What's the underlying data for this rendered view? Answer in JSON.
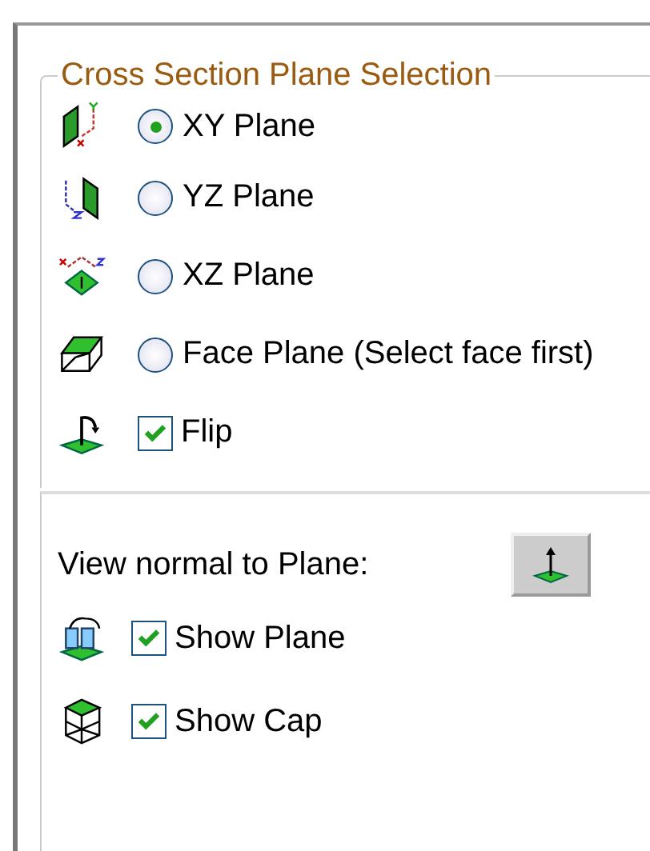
{
  "group": {
    "title": "Cross Section Plane Selection",
    "options": [
      {
        "kind": "radio",
        "label": "XY Plane",
        "selected": true
      },
      {
        "kind": "radio",
        "label": "YZ Plane",
        "selected": false
      },
      {
        "kind": "radio",
        "label": "XZ Plane",
        "selected": false
      },
      {
        "kind": "radio",
        "label": "Face Plane (Select face first)",
        "selected": false
      },
      {
        "kind": "checkbox",
        "label": "Flip",
        "checked": true
      }
    ]
  },
  "view_normal": {
    "label": "View normal to Plane:"
  },
  "display_options": [
    {
      "label": "Show Plane",
      "checked": true
    },
    {
      "label": "Show Cap",
      "checked": true
    }
  ]
}
